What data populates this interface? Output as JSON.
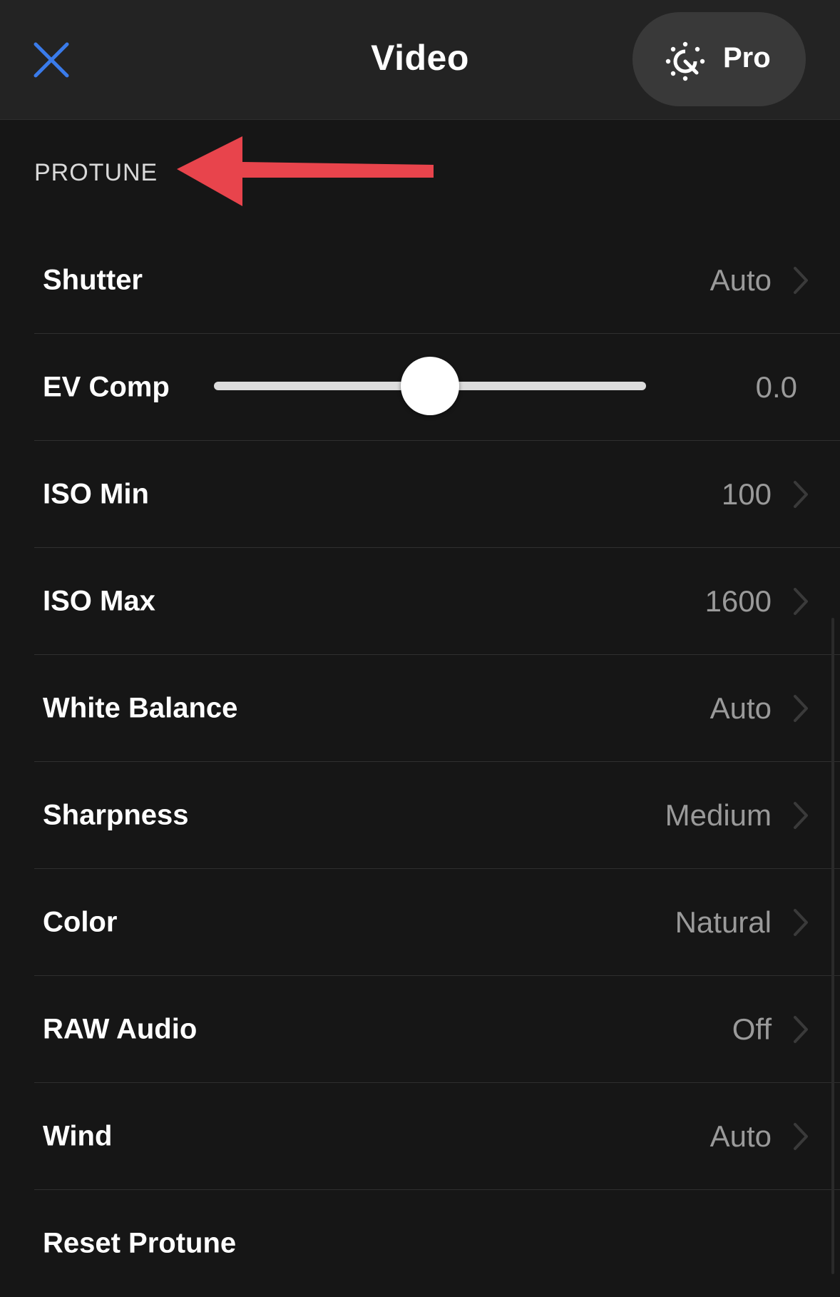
{
  "header": {
    "title": "Video",
    "close_icon": "close-icon",
    "pro_button": {
      "label": "Pro",
      "icon": "protune-dial-icon"
    }
  },
  "section": {
    "title": "PROTUNE",
    "annotation": {
      "icon": "red-arrow-annotation",
      "color": "#e8444c"
    }
  },
  "settings": {
    "shutter": {
      "label": "Shutter",
      "value": "Auto"
    },
    "ev_comp": {
      "label": "EV Comp",
      "value": "0.0",
      "slider_fraction": 0.5
    },
    "iso_min": {
      "label": "ISO Min",
      "value": "100"
    },
    "iso_max": {
      "label": "ISO Max",
      "value": "1600"
    },
    "white_balance": {
      "label": "White Balance",
      "value": "Auto"
    },
    "sharpness": {
      "label": "Sharpness",
      "value": "Medium"
    },
    "color": {
      "label": "Color",
      "value": "Natural"
    },
    "raw_audio": {
      "label": "RAW Audio",
      "value": "Off"
    },
    "wind": {
      "label": "Wind",
      "value": "Auto"
    },
    "reset": {
      "label": "Reset Protune"
    }
  },
  "colors": {
    "accent": "#3a7bea",
    "background": "#161616",
    "header_background": "#232323",
    "value_text": "#9a9a9a"
  }
}
